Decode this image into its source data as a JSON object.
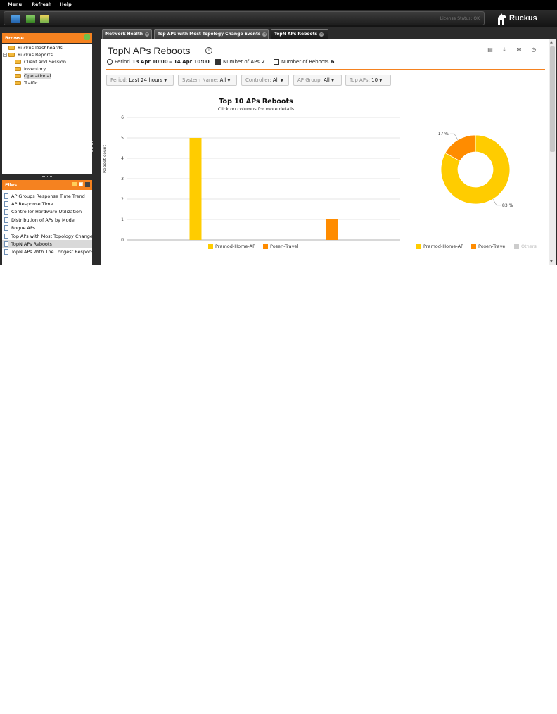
{
  "menu": {
    "items": [
      "Menu",
      "Refresh",
      "Help"
    ]
  },
  "toolbar": {
    "license_status": "License Status: OK"
  },
  "brand": {
    "logo_text": "Ruckus"
  },
  "browse": {
    "header": "Browse",
    "tree": [
      {
        "label": "Ruckus Dashboards",
        "level": 1
      },
      {
        "label": "Ruckus Reports",
        "level": 0
      },
      {
        "label": "Client and Session",
        "level": 2
      },
      {
        "label": "Inventory",
        "level": 2
      },
      {
        "label": "Operational",
        "level": 2,
        "selected": true
      },
      {
        "label": "Traffic",
        "level": 2
      }
    ]
  },
  "files": {
    "header": "Files",
    "items": [
      "AP Groups Response Time Trend",
      "AP Response Time",
      "Controller Hardware Utilization",
      "Distribution of APs by Model",
      "Rogue APs",
      "Top APs with Most Topology Change",
      "TopN APs Reboots",
      "TopN APs With The Longest Response"
    ],
    "selected_index": 6
  },
  "tabs": [
    {
      "label": "Network Health"
    },
    {
      "label": "Top APs with Most Topology Change Events"
    },
    {
      "label": "TopN APs Reboots",
      "active": true
    }
  ],
  "report": {
    "title": "TopN APs Reboots",
    "period_label": "Period",
    "period_value": "13 Apr 10:00 – 14 Apr 10:00",
    "num_aps_label": "Number of APs",
    "num_aps_value": "2",
    "num_reboots_label": "Number of Reboots",
    "num_reboots_value": "6",
    "action_icons": [
      "document-icon",
      "download-icon",
      "email-icon",
      "clock-icon"
    ]
  },
  "filters": [
    {
      "label": "Period:",
      "value": "Last 24 hours"
    },
    {
      "label": "System Name:",
      "value": "All"
    },
    {
      "label": "Controller:",
      "value": "All"
    },
    {
      "label": "AP Group:",
      "value": "All"
    },
    {
      "label": "Top APs:",
      "value": "10"
    }
  ],
  "colors": {
    "accent": "#f58220",
    "series1": "#ffcc00",
    "series2": "#ff8c00",
    "others": "#cccccc"
  },
  "chart_data": [
    {
      "type": "bar",
      "title": "Top 10 APs Reboots",
      "subtitle": "Click on columns for more details",
      "ylabel": "Reboot count",
      "ylim": [
        0,
        6
      ],
      "yticks": [
        0,
        1,
        2,
        3,
        4,
        5,
        6
      ],
      "grid": true,
      "series": [
        {
          "name": "Pramod-Home-AP",
          "values": [
            5
          ],
          "color": "#ffcc00"
        },
        {
          "name": "Posen-Travel",
          "values": [
            1
          ],
          "color": "#ff8c00"
        }
      ],
      "legend": "bottom"
    },
    {
      "type": "pie",
      "style": "donut",
      "slices": [
        {
          "name": "Pramod-Home-AP",
          "value": 83,
          "label": "83 %",
          "color": "#ffcc00"
        },
        {
          "name": "Posen-Travel",
          "value": 17,
          "label": "17 %",
          "color": "#ff8c00"
        },
        {
          "name": "Others",
          "value": 0,
          "color": "#cccccc"
        }
      ],
      "legend": "bottom"
    }
  ]
}
